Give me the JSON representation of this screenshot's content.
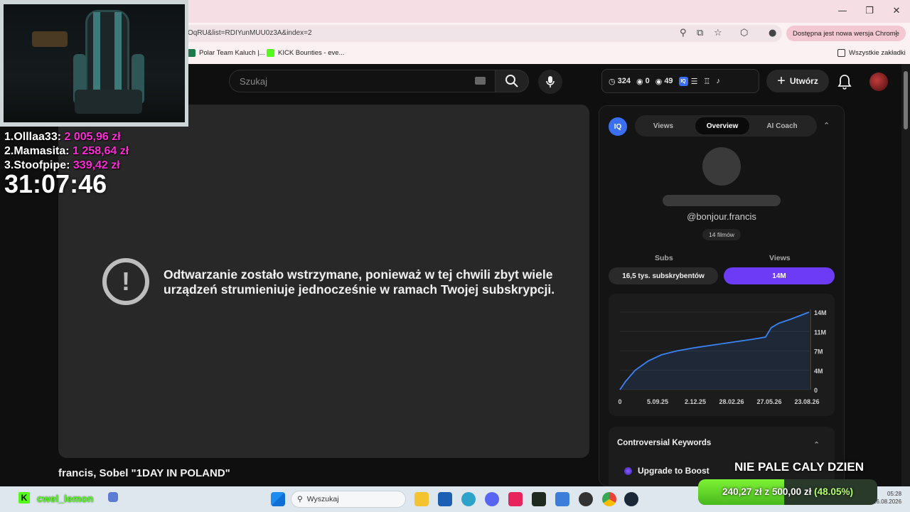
{
  "browser": {
    "url": "OqRU&list=RDIYunMUU0z3A&index=2",
    "update_label": "Dostępna jest nowa wersja Chrome",
    "bookmarks": [
      {
        "label": "Polar Team Kaluch |..."
      },
      {
        "label": "KICK Bounties - eve..."
      }
    ],
    "all_bookmarks": "Wszystkie zakładki"
  },
  "youtube": {
    "search_placeholder": "Szukaj",
    "stats": {
      "a": "324",
      "b": "0",
      "c": "49"
    },
    "create_label": "Utwórz"
  },
  "player": {
    "error_message": "Odtwarzanie zostało wstrzymane, ponieważ w tej chwili zbyt wiele urządzeń strumieniuje jednocześnie w ramach Twojej subskrypcji.",
    "video_title": "francis, Sobel \"1DAY IN POLAND\""
  },
  "overlay": {
    "leaderboard": [
      {
        "rank": "1.",
        "name": "Olllaa33:",
        "amount": "2 005,96 zł"
      },
      {
        "rank": "2.",
        "name": "Mamasita:",
        "amount": "1 258,64 zł"
      },
      {
        "rank": "3.",
        "name": "Stoofpipe:",
        "amount": "339,42 zł"
      }
    ],
    "timer": "31:07:46",
    "banner": "NIE PALE CALY DZIEN",
    "goal": {
      "current": "240,27 zł",
      "target": "500,00 zł",
      "percent_label": "(48.05%)",
      "fraction": 0.4805
    },
    "kick_username": "cwel_lemon"
  },
  "panel": {
    "tabs": [
      "Views",
      "Overview",
      "AI Coach"
    ],
    "active_tab": "Overview",
    "handle": "@bonjour.francis",
    "films": "14 filmów",
    "subs_head": "Subs",
    "views_head": "Views",
    "subs_value": "16,5 tys. subskrybentów",
    "views_value": "14M",
    "keywords_title": "Controversial Keywords",
    "boost_label": "Upgrade to Boost"
  },
  "chart_data": {
    "type": "line",
    "x_tick_labels": [
      "0",
      "5.09.25",
      "2.12.25",
      "28.02.26",
      "27.05.26",
      "23.08.26"
    ],
    "y_tick_labels": [
      "0",
      "4M",
      "7M",
      "11M",
      "14M"
    ],
    "ylim": [
      0,
      14
    ],
    "x": [
      0,
      0.03,
      0.08,
      0.15,
      0.22,
      0.3,
      0.4,
      0.5,
      0.6,
      0.7,
      0.77,
      0.8,
      0.84,
      0.9,
      1.0
    ],
    "values": [
      0,
      1.5,
      3.5,
      5.2,
      6.3,
      7.0,
      7.6,
      8.1,
      8.6,
      9.1,
      9.5,
      11.2,
      12.0,
      12.7,
      14.0
    ],
    "series": [
      {
        "values": [
          0,
          1.5,
          3.5,
          5.2,
          6.3,
          7.0,
          7.6,
          8.1,
          8.6,
          9.1,
          9.5,
          11.2,
          12.0,
          12.7,
          14.0
        ]
      }
    ],
    "color": "#3b82f6"
  },
  "taskbar": {
    "search_placeholder": "Wyszukaj",
    "time": "05:28",
    "date": "26.08.2026"
  },
  "colors": {
    "accent_purple": "#6d3bf5",
    "donation_pink": "#ff2bd6",
    "kick_green": "#53fc18"
  }
}
